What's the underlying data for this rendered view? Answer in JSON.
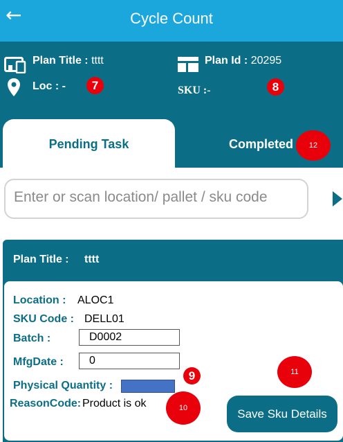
{
  "app": {
    "title": "Cycle Count"
  },
  "header": {
    "plan_title_label": "Plan Title :",
    "plan_title_value": "tttt",
    "plan_id_label": "Plan Id :",
    "plan_id_value": "20295",
    "loc_label": "Loc :",
    "loc_value": "-",
    "sku_label": "SKU :-"
  },
  "tabs": {
    "pending": "Pending Task",
    "completed": "Completed"
  },
  "search": {
    "placeholder": "Enter or scan location/ pallet / sku code"
  },
  "card": {
    "plan_title_label": "Plan Title :",
    "plan_title_value": "tttt",
    "location_label": "Location :",
    "location_value": "ALOC1",
    "sku_code_label": "SKU Code :",
    "sku_code_value": "DELL01",
    "batch_label": "Batch :",
    "batch_value": "D0002",
    "mfg_date_label": "MfgDate :",
    "mfg_date_value": "0",
    "physical_qty_label": "Physical Quantity :",
    "reason_code_label": "ReasonCode:",
    "reason_code_value": "Product is ok",
    "save_label": "Save Sku Details"
  },
  "badges": {
    "b7": "7",
    "b8": "8",
    "b9": "9",
    "b10": "10",
    "b11": "11",
    "b12": "12"
  },
  "colors": {
    "appbar": "#1ba7dc",
    "teal": "#0b6e86",
    "badge": "#e8000b",
    "qty_fill": "#4472c4"
  }
}
